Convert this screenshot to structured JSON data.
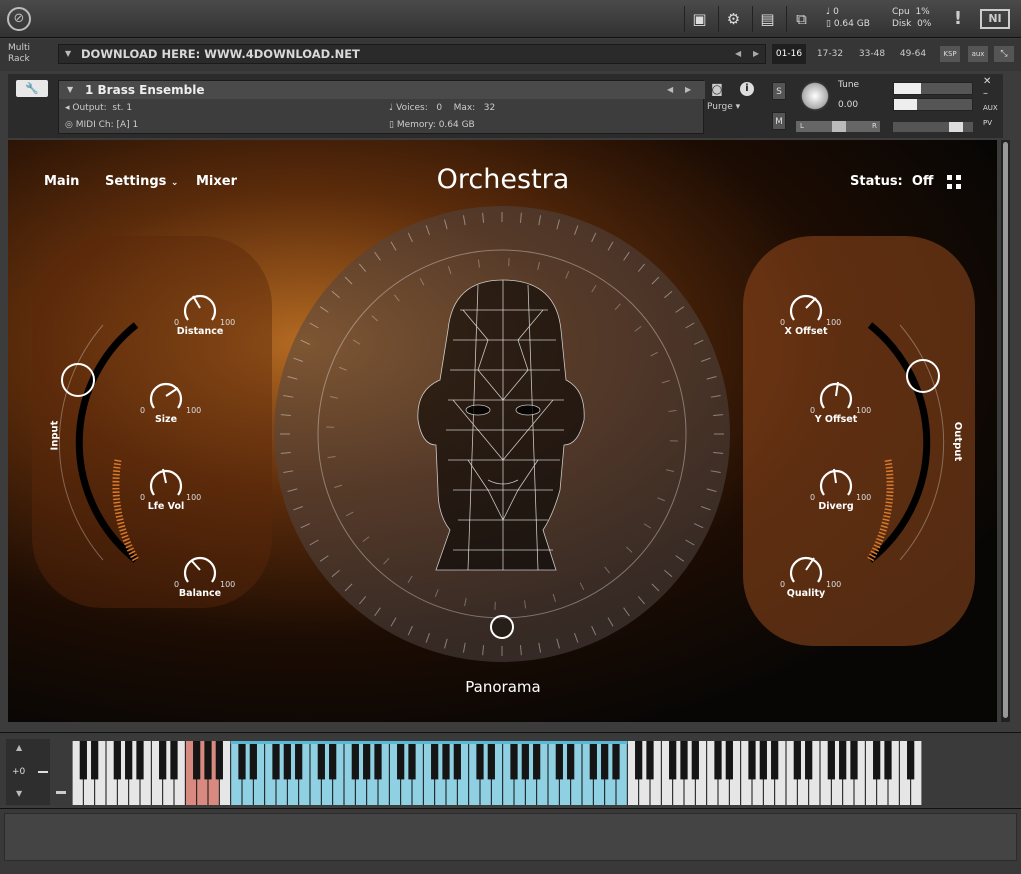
{
  "topbar": {
    "voices_label": "0",
    "memory_label": "0.64 GB",
    "cpu_label": "Cpu",
    "cpu_value": "1%",
    "disk_label": "Disk",
    "disk_value": "0%",
    "ni_logo": "NI",
    "warning": "!"
  },
  "rack": {
    "multi_rack": "Multi Rack",
    "download_text": "DOWNLOAD HERE: WWW.4DOWNLOAD.NET",
    "page_tabs": [
      "01-16",
      "17-32",
      "33-48",
      "49-64"
    ],
    "ksp": "KSP",
    "aux": "aux"
  },
  "instrument": {
    "name": "1 Brass Ensemble",
    "output_label": "Output:",
    "output_value": "st. 1",
    "midi_label": "MIDI Ch:",
    "midi_value": "[A]  1",
    "voices_label": "Voices:",
    "voices_value": "0",
    "max_label": "Max:",
    "max_value": "32",
    "memory_label": "Memory:",
    "memory_value": "0.64 GB",
    "purge": "Purge",
    "solo": "S",
    "mute": "M",
    "tune_label": "Tune",
    "tune_value": "0.00",
    "pan_l": "L",
    "pan_r": "R",
    "aux_label": "AUX",
    "pv_label": "PV"
  },
  "main": {
    "nav_main": "Main",
    "nav_settings": "Settings",
    "nav_mixer": "Mixer",
    "title": "Orchestra",
    "status_label": "Status:",
    "status_value": "Off",
    "input_label": "Input",
    "output_label": "Output",
    "panorama_label": "Panorama",
    "knob_min": "0",
    "knob_max": "100",
    "left_knobs": [
      "Distance",
      "Size",
      "Lfe Vol",
      "Balance"
    ],
    "right_knobs": [
      "X Offset",
      "Y Offset",
      "Diverg",
      "Quality"
    ]
  },
  "keyboard": {
    "octave": "+0"
  }
}
